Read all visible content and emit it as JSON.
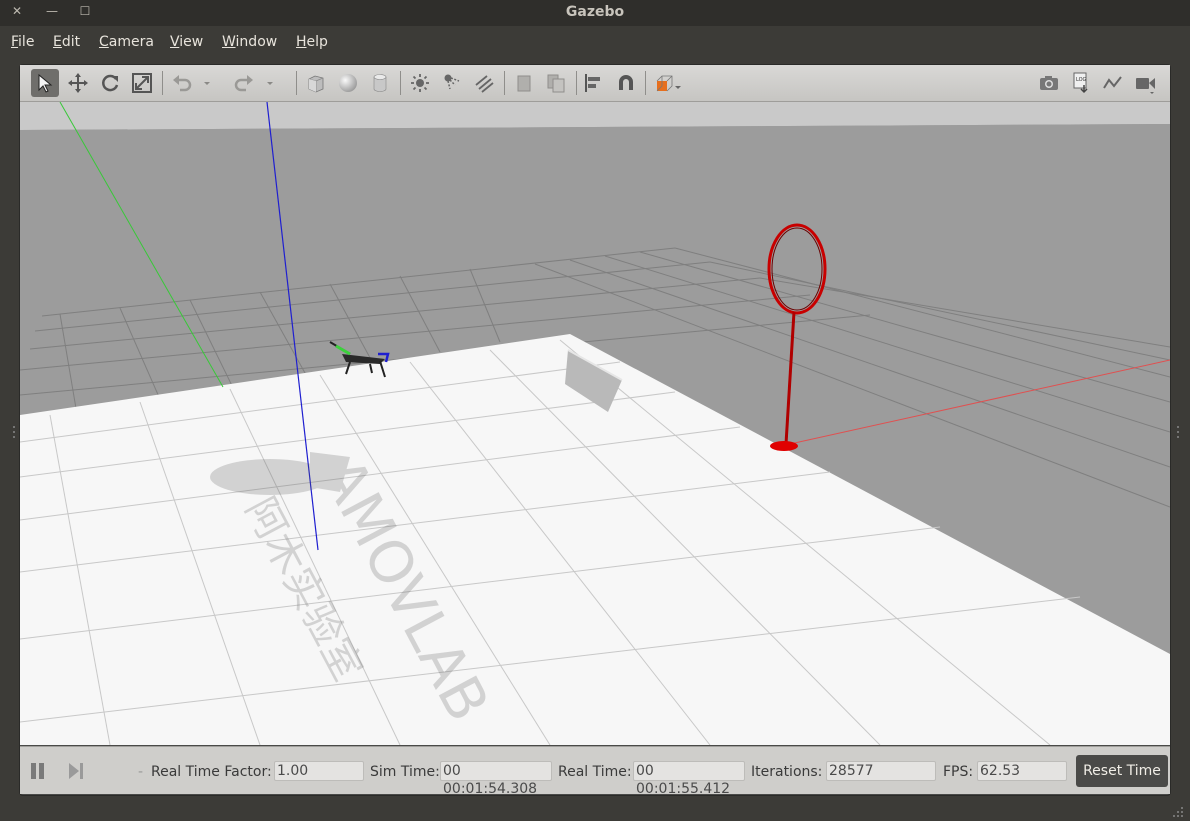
{
  "window": {
    "title": "Gazebo",
    "controls": [
      "close-icon",
      "minimize-icon",
      "maximize-icon"
    ]
  },
  "menu": [
    {
      "label": "File",
      "underline": "F",
      "rest": "ile"
    },
    {
      "label": "Edit",
      "underline": "E",
      "rest": "dit"
    },
    {
      "label": "Camera",
      "underline": "C",
      "rest": "amera"
    },
    {
      "label": "View",
      "underline": "V",
      "rest": "iew"
    },
    {
      "label": "Window",
      "underline": "W",
      "rest": "indow"
    },
    {
      "label": "Help",
      "underline": "H",
      "rest": "elp"
    }
  ],
  "toolbar": {
    "left_tools": [
      "select-arrow-icon",
      "translate-icon",
      "rotate-icon",
      "scale-icon",
      "undo-icon",
      "undo-dropdown-icon",
      "redo-icon",
      "redo-dropdown-icon",
      "box-shape-icon",
      "sphere-shape-icon",
      "cylinder-shape-icon",
      "point-light-icon",
      "spot-light-icon",
      "directional-light-icon",
      "copy-icon",
      "paste-icon",
      "align-icon",
      "snap-magnet-icon",
      "view-angle-icon"
    ],
    "right_tools": [
      "screenshot-camera-icon",
      "log-icon",
      "plot-icon",
      "video-record-icon"
    ],
    "active_tool": "select-arrow-icon",
    "accent_color": "#e66f1e"
  },
  "scene": {
    "watermark_brand": "AMOVLAB",
    "watermark_cn": "阿木实验室",
    "objects": [
      "quadcopter-model",
      "red-ring-gate",
      "white-panel"
    ],
    "colors": {
      "sky": "#9a9a9a",
      "ground": "#f7f7f7",
      "ring": "#cc0000"
    }
  },
  "status": {
    "real_time_factor_label": "Real Time Factor:",
    "real_time_factor": "1.00",
    "sim_time_label": "Sim Time:",
    "sim_time": "00 00:01:54.308",
    "real_time_label": "Real Time:",
    "real_time": "00 00:01:55.412",
    "iterations_label": "Iterations:",
    "iterations": "28577",
    "fps_label": "FPS:",
    "fps": "62.53",
    "reset_label": "Reset Time",
    "step_marker": "-"
  }
}
